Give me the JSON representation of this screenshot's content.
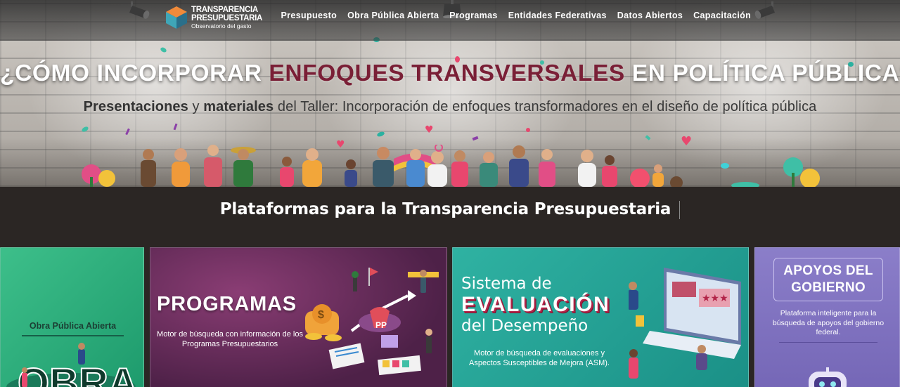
{
  "logo": {
    "line1": "TRANSPARENCIA",
    "line2": "PRESUPUESTARIA",
    "line3": "Observatorio del gasto"
  },
  "nav": {
    "items": [
      {
        "label": "Presupuesto"
      },
      {
        "label": "Obra Pública Abierta"
      },
      {
        "label": "Programas"
      },
      {
        "label": "Entidades Federativas"
      },
      {
        "label": "Datos Abiertos"
      },
      {
        "label": "Capacitación"
      }
    ]
  },
  "hero": {
    "headline_pre": "¿CÓMO INCORPORAR ",
    "headline_accent": "ENFOQUES TRANSVERSALES",
    "headline_post": " EN POLÍTICA PÚBLICA?",
    "sub_b1": "Presentaciones",
    "sub_y": " y ",
    "sub_b2": "materiales",
    "sub_rest": " del Taller: Incorporación de enfoques transformadores en el diseño de política pública"
  },
  "section": {
    "title": "Plataformas para la Transparencia Presupuestaria"
  },
  "cards": {
    "obra": {
      "title": "Obra Pública Abierta",
      "art_text": "OBRA"
    },
    "programas": {
      "title": "PROGRAMAS",
      "description": "Motor de búsqueda con información de los Programas Presupuestarios",
      "art_badge": "PP"
    },
    "sed": {
      "title_line1": "Sistema de",
      "title_line2": "EVALUACIÓN",
      "title_line3": "del Desempeño",
      "description": "Motor de búsqueda de evaluaciones y Aspectos Susceptibles de Mejora (ASM)."
    },
    "apoyos": {
      "title_line1": "APOYOS DEL",
      "title_line2": "GOBIERNO",
      "description": "Plataforma inteligente para la búsqueda de apoyos del gobierno federal."
    }
  },
  "colors": {
    "accent_maroon": "#7a1f36",
    "band_bg": "#2b2624",
    "obra_green": "#2bb07e",
    "programas_purple": "#6a2c5f",
    "sed_teal": "#23a396",
    "apoyos_violet": "#8072c0"
  },
  "icons": [
    "spotlight-icon",
    "logo-cube-icon",
    "heart-icon",
    "robot-icon"
  ]
}
